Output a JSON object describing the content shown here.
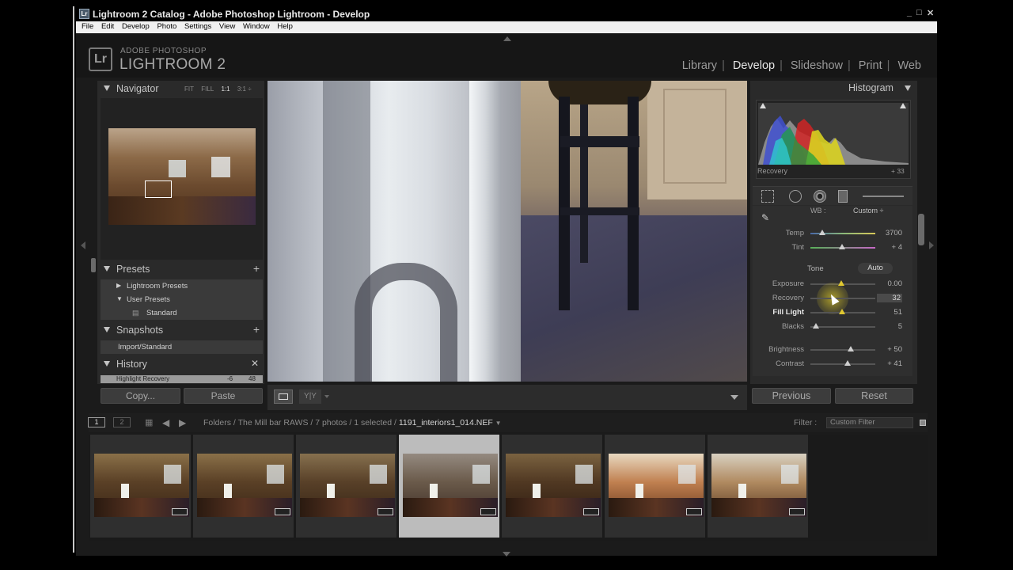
{
  "window": {
    "title": "Lightroom 2 Catalog - Adobe Photoshop Lightroom - Develop",
    "icon": "Lr",
    "controls": [
      "_",
      "□",
      "✕"
    ]
  },
  "menu": [
    "File",
    "Edit",
    "Develop",
    "Photo",
    "Settings",
    "View",
    "Window",
    "Help"
  ],
  "logo": {
    "mark": "Lr",
    "sub": "ADOBE PHOTOSHOP",
    "name": "LIGHTROOM 2"
  },
  "modules": [
    {
      "label": "Library",
      "active": false
    },
    {
      "label": "Develop",
      "active": true
    },
    {
      "label": "Slideshow",
      "active": false
    },
    {
      "label": "Print",
      "active": false
    },
    {
      "label": "Web",
      "active": false
    }
  ],
  "navigator": {
    "title": "Navigator",
    "options": [
      "FIT",
      "FILL",
      "1:1",
      "3:1 ÷"
    ]
  },
  "presets": {
    "title": "Presets",
    "items": [
      "Lightroom Presets",
      "User Presets",
      "Standard"
    ]
  },
  "snapshots": {
    "title": "Snapshots",
    "items": [
      "Import/Standard"
    ]
  },
  "history": {
    "title": "History",
    "first_item": "Highlight Recovery",
    "first_a": "-6",
    "first_b": "48"
  },
  "left_buttons": {
    "copy": "Copy...",
    "paste": "Paste"
  },
  "histogram": {
    "title": "Histogram",
    "label": "Recovery",
    "value": "+ 33"
  },
  "basic": {
    "wb_label": "WB :",
    "wb_value": "Custom ÷",
    "temp_label": "Temp",
    "temp_value": "3700",
    "tint_label": "Tint",
    "tint_value": "+ 4",
    "tone_label": "Tone",
    "auto_label": "Auto",
    "exposure_label": "Exposure",
    "exposure_value": "0.00",
    "recovery_label": "Recovery",
    "recovery_value": "32",
    "filllight_label": "Fill Light",
    "filllight_value": "51",
    "blacks_label": "Blacks",
    "blacks_value": "5",
    "brightness_label": "Brightness",
    "brightness_value": "+ 50",
    "contrast_label": "Contrast",
    "contrast_value": "+ 41"
  },
  "right_buttons": {
    "previous": "Previous",
    "reset": "Reset"
  },
  "filmstrip_bar": {
    "monitor1": "1",
    "monitor2": "2",
    "path": "Folders / The Mill bar RAWS / 7 photos / 1 selected /",
    "filename": "1191_interiors1_014.NEF",
    "filter_label": "Filter :",
    "filter_value": "Custom Filter"
  },
  "filmstrip_count": 7,
  "selected_index": 3,
  "colors": {
    "accent": "#e0c830",
    "panel": "#2a2a2a",
    "selected_cell": "#bcbcbc"
  }
}
